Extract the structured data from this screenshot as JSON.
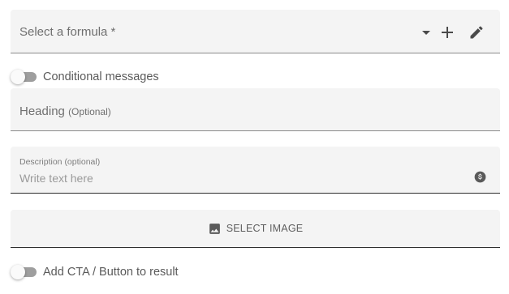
{
  "formula": {
    "label": "Select a formula *",
    "icons": [
      "dropdown-arrow-icon",
      "add-icon",
      "edit-icon"
    ]
  },
  "conditional_messages": {
    "label": "Conditional messages",
    "enabled": false
  },
  "heading": {
    "label": "Heading",
    "optional": "(Optional)"
  },
  "description": {
    "label": "Description (optional)",
    "placeholder": "Write text here",
    "icon": "dollar-icon"
  },
  "image": {
    "label": "SELECT IMAGE",
    "icon": "image-icon"
  },
  "cta": {
    "label": "Add CTA / Button to result",
    "enabled": false
  }
}
